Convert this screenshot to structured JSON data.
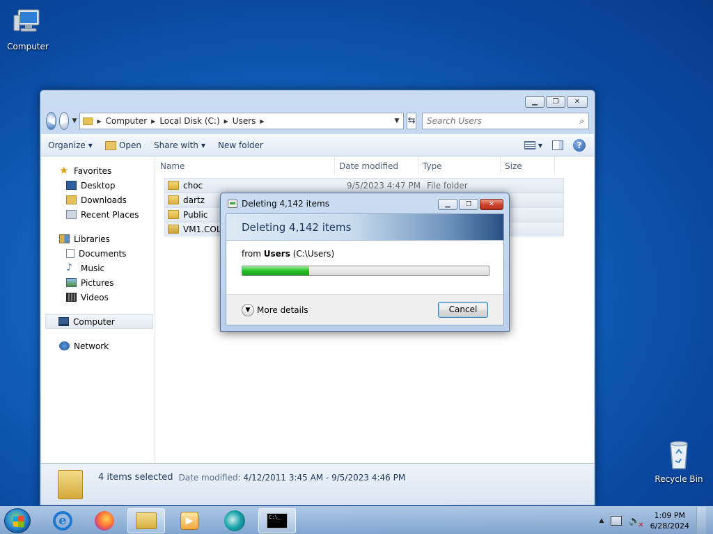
{
  "desktop": {
    "icons": [
      {
        "label": "Computer",
        "icon": "computer-icon"
      },
      {
        "label": "Recycle Bin",
        "icon": "recycle-bin-icon"
      }
    ]
  },
  "explorer": {
    "breadcrumb": [
      "Computer",
      "Local Disk (C:)",
      "Users"
    ],
    "search_placeholder": "Search Users",
    "toolbar": {
      "organize": "Organize",
      "open": "Open",
      "share_with": "Share with",
      "new_folder": "New folder"
    },
    "nav": {
      "favorites": "Favorites",
      "desktop": "Desktop",
      "downloads": "Downloads",
      "recent_places": "Recent Places",
      "libraries": "Libraries",
      "documents": "Documents",
      "music": "Music",
      "pictures": "Pictures",
      "videos": "Videos",
      "computer": "Computer",
      "network": "Network"
    },
    "columns": {
      "name": "Name",
      "date_modified": "Date modified",
      "type": "Type",
      "size": "Size"
    },
    "files": [
      {
        "name": "choc",
        "date": "9/5/2023 4:47 PM",
        "type": "File folder"
      },
      {
        "name": "dartz",
        "date": "",
        "type": ""
      },
      {
        "name": "Public",
        "date": "",
        "type": ""
      },
      {
        "name": "VM1.COLL",
        "date": "",
        "type": ""
      }
    ],
    "details": {
      "count": "4 items selected",
      "modified_label": "Date modified:",
      "modified_value": "4/12/2011 3:45 AM - 9/5/2023 4:46 PM"
    }
  },
  "dialog": {
    "title": "Deleting 4,142 items",
    "heading": "Deleting 4,142 items",
    "from_prefix": "from",
    "from_bold": "Users",
    "from_path": "(C:\\Users)",
    "progress_percent": 27,
    "more_details": "More details",
    "cancel": "Cancel"
  },
  "taskbar": {
    "apps": [
      "internet-explorer",
      "firefox",
      "windows-explorer",
      "media-player",
      "ghost-app",
      "command-prompt"
    ],
    "cmd_text": "C:\\_",
    "time": "1:09 PM",
    "date": "6/28/2024"
  },
  "colors": {
    "desktop_blue": "#1566c2",
    "progress_green": "#25c025",
    "close_red": "#c9402b"
  }
}
